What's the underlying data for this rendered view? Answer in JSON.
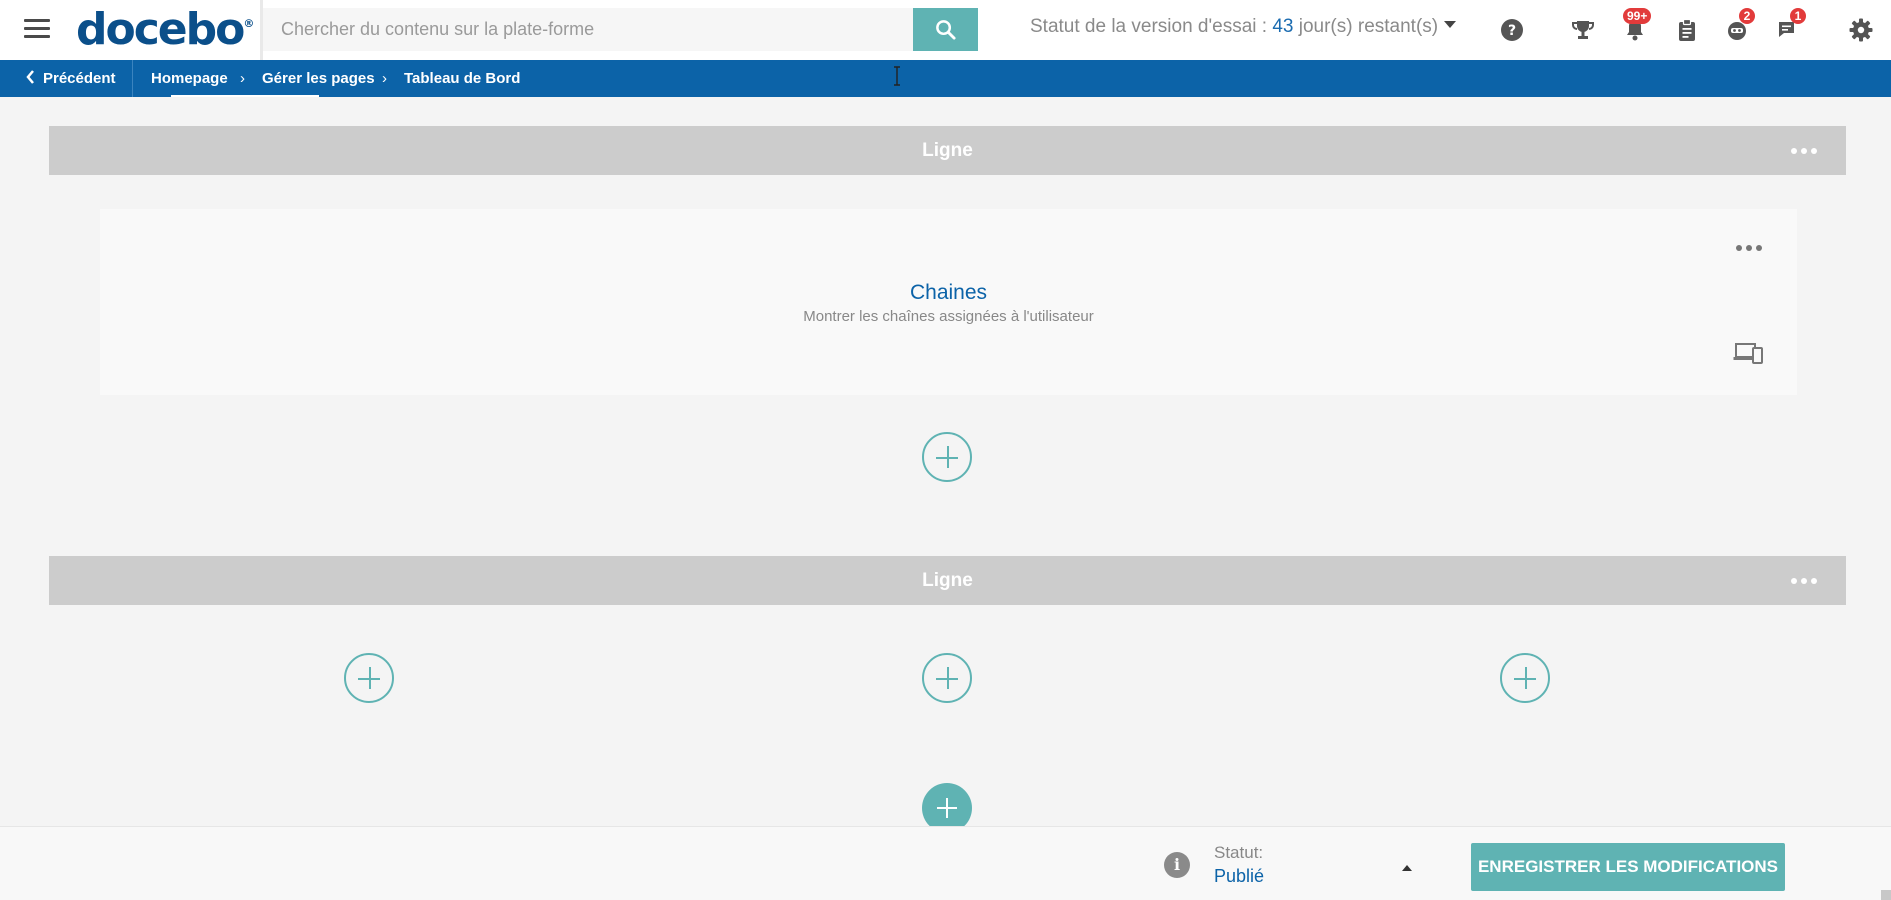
{
  "header": {
    "logo_text": "docebo",
    "logo_mark": "®",
    "search_placeholder": "Chercher du contenu sur la plate-forme",
    "trial_prefix": "Statut de la version d'essai :",
    "trial_days": "43",
    "trial_suffix": "jour(s) restant(s)",
    "icons": [
      "menu-icon",
      "search-icon",
      "help-icon",
      "trophy-icon",
      "bell-icon",
      "clipboard-icon",
      "robot-icon",
      "chat-icon",
      "gear-icon"
    ],
    "badges": {
      "notifications": "99+",
      "assistant": "2",
      "messages": "1"
    },
    "accent_color": "#5fb3b3",
    "badge_color": "#e23b3b"
  },
  "breadcrumb": {
    "back_label": "Précédent",
    "items": [
      "Homepage",
      "Gérer les pages",
      "Tableau de Bord"
    ],
    "bar_color": "#0c63a8"
  },
  "rows": [
    {
      "label": "Ligne"
    },
    {
      "label": "Ligne"
    }
  ],
  "widget": {
    "title": "Chaines",
    "subtitle": "Montrer les chaînes assignées à l'utilisateur"
  },
  "footer": {
    "status_label": "Statut:",
    "status_value": "Publié",
    "save_label": "ENREGISTRER LES MODIFICATIONS"
  }
}
